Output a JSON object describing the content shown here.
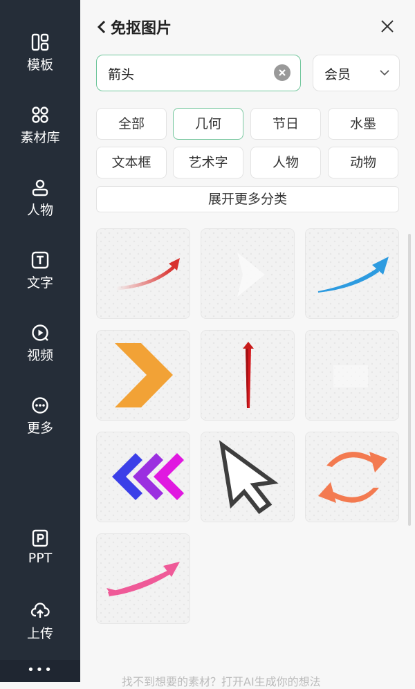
{
  "sidebar": {
    "items": [
      {
        "label": "模板",
        "icon": "template-icon"
      },
      {
        "label": "素材库",
        "icon": "assets-icon"
      },
      {
        "label": "人物",
        "icon": "person-icon"
      },
      {
        "label": "文字",
        "icon": "text-icon"
      },
      {
        "label": "视频",
        "icon": "video-icon"
      },
      {
        "label": "更多",
        "icon": "more-icon"
      },
      {
        "label": "PPT",
        "icon": "ppt-icon"
      },
      {
        "label": "上传",
        "icon": "upload-icon"
      }
    ],
    "more_dots": "•••"
  },
  "panel": {
    "title": "免抠图片",
    "search": {
      "value": "箭头"
    },
    "member_select": {
      "value": "会员"
    },
    "categories": [
      "全部",
      "几何",
      "节日",
      "水墨",
      "文本框",
      "艺术字",
      "人物",
      "动物"
    ],
    "active_category": "几何",
    "expand_label": "展开更多分类",
    "results": [
      {
        "name": "red-curved-arrow"
      },
      {
        "name": "white-arrow"
      },
      {
        "name": "blue-curved-arrow"
      },
      {
        "name": "orange-chevron"
      },
      {
        "name": "red-vertical-arrow"
      },
      {
        "name": "white-image"
      },
      {
        "name": "gradient-triple-chevrons"
      },
      {
        "name": "cursor-pointer"
      },
      {
        "name": "orange-cycle-arrows"
      },
      {
        "name": "pink-curved-arrow"
      }
    ],
    "footer_hint": "找不到想要的素材？打开AI生成你的想法"
  },
  "colors": {
    "sidebar_bg": "#252d38",
    "accent_green": "#6fc69b",
    "panel_bg": "#f7f7f7"
  }
}
